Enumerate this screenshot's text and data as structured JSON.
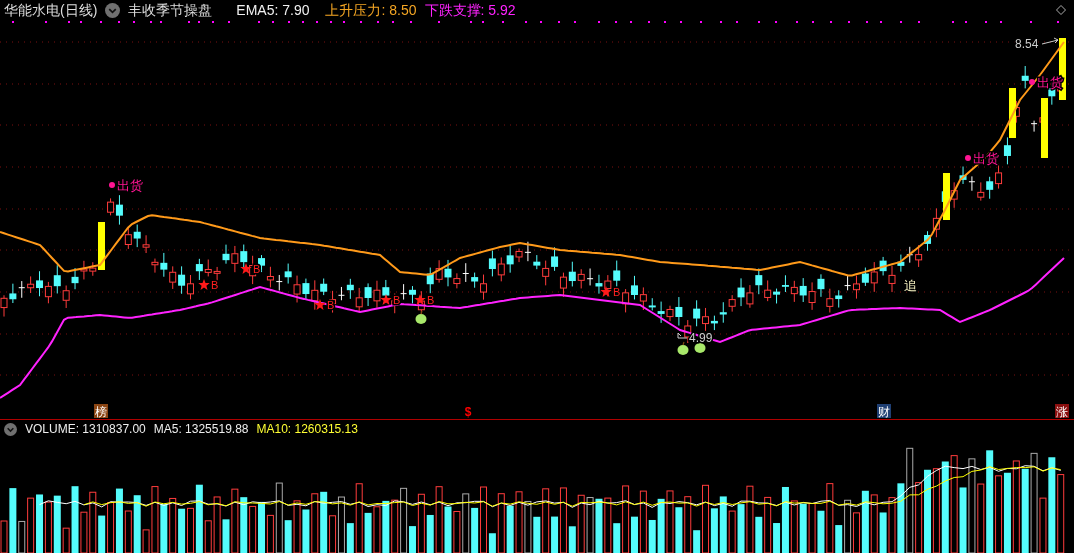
{
  "header": {
    "stock_title": "华能水电(日线)",
    "indicator_name": "丰收季节操盘",
    "ema": "EMA5: 7.90",
    "resistance": "上升压力: 8.50",
    "support": "下跌支撑: 5.92"
  },
  "price_chart": {
    "signals": [
      {
        "kind": "sell",
        "label": "出货"
      },
      {
        "kind": "buy",
        "label": "B"
      },
      {
        "kind": "buy",
        "label": "B"
      },
      {
        "kind": "buy",
        "label": "B"
      },
      {
        "kind": "buy",
        "label": "B"
      },
      {
        "kind": "buy",
        "label": "B"
      },
      {
        "kind": "buy",
        "label": "B"
      },
      {
        "kind": "sell",
        "label": "出货"
      },
      {
        "kind": "sell",
        "label": "出货"
      }
    ],
    "high_label": "8.54",
    "low_label": "4.99",
    "chase_label": "追"
  },
  "event_markers": [
    {
      "label": "榜",
      "kind": "tag",
      "color": "#8b4513"
    },
    {
      "label": "$",
      "kind": "glyph",
      "color": "#ff0000"
    },
    {
      "label": "财",
      "kind": "tag",
      "color": "#1f3f73"
    },
    {
      "label": "涨",
      "kind": "tag",
      "color": "#8b1010"
    }
  ],
  "volume": {
    "title": "VOLUME: 1310837.00",
    "ma5": "MA5: 1325519.88",
    "ma10": "MA10: 1260315.13"
  }
}
